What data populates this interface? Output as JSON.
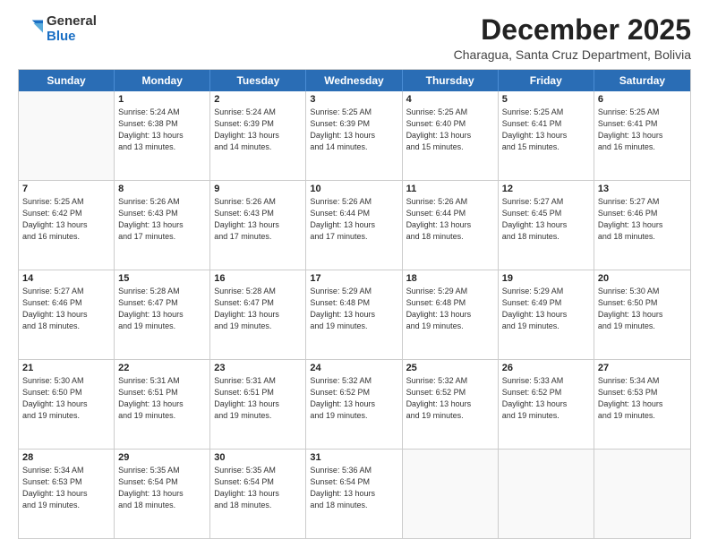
{
  "logo": {
    "general": "General",
    "blue": "Blue"
  },
  "header": {
    "month": "December 2025",
    "subtitle": "Charagua, Santa Cruz Department, Bolivia"
  },
  "days": [
    "Sunday",
    "Monday",
    "Tuesday",
    "Wednesday",
    "Thursday",
    "Friday",
    "Saturday"
  ],
  "weeks": [
    [
      {
        "day": "",
        "empty": true
      },
      {
        "day": "1",
        "sunrise": "Sunrise: 5:24 AM",
        "sunset": "Sunset: 6:38 PM",
        "daylight": "Daylight: 13 hours and 13 minutes."
      },
      {
        "day": "2",
        "sunrise": "Sunrise: 5:24 AM",
        "sunset": "Sunset: 6:39 PM",
        "daylight": "Daylight: 13 hours and 14 minutes."
      },
      {
        "day": "3",
        "sunrise": "Sunrise: 5:25 AM",
        "sunset": "Sunset: 6:39 PM",
        "daylight": "Daylight: 13 hours and 14 minutes."
      },
      {
        "day": "4",
        "sunrise": "Sunrise: 5:25 AM",
        "sunset": "Sunset: 6:40 PM",
        "daylight": "Daylight: 13 hours and 15 minutes."
      },
      {
        "day": "5",
        "sunrise": "Sunrise: 5:25 AM",
        "sunset": "Sunset: 6:41 PM",
        "daylight": "Daylight: 13 hours and 15 minutes."
      },
      {
        "day": "6",
        "sunrise": "Sunrise: 5:25 AM",
        "sunset": "Sunset: 6:41 PM",
        "daylight": "Daylight: 13 hours and 16 minutes."
      }
    ],
    [
      {
        "day": "7",
        "sunrise": "Sunrise: 5:25 AM",
        "sunset": "Sunset: 6:42 PM",
        "daylight": "Daylight: 13 hours and 16 minutes."
      },
      {
        "day": "8",
        "sunrise": "Sunrise: 5:26 AM",
        "sunset": "Sunset: 6:43 PM",
        "daylight": "Daylight: 13 hours and 17 minutes."
      },
      {
        "day": "9",
        "sunrise": "Sunrise: 5:26 AM",
        "sunset": "Sunset: 6:43 PM",
        "daylight": "Daylight: 13 hours and 17 minutes."
      },
      {
        "day": "10",
        "sunrise": "Sunrise: 5:26 AM",
        "sunset": "Sunset: 6:44 PM",
        "daylight": "Daylight: 13 hours and 17 minutes."
      },
      {
        "day": "11",
        "sunrise": "Sunrise: 5:26 AM",
        "sunset": "Sunset: 6:44 PM",
        "daylight": "Daylight: 13 hours and 18 minutes."
      },
      {
        "day": "12",
        "sunrise": "Sunrise: 5:27 AM",
        "sunset": "Sunset: 6:45 PM",
        "daylight": "Daylight: 13 hours and 18 minutes."
      },
      {
        "day": "13",
        "sunrise": "Sunrise: 5:27 AM",
        "sunset": "Sunset: 6:46 PM",
        "daylight": "Daylight: 13 hours and 18 minutes."
      }
    ],
    [
      {
        "day": "14",
        "sunrise": "Sunrise: 5:27 AM",
        "sunset": "Sunset: 6:46 PM",
        "daylight": "Daylight: 13 hours and 18 minutes."
      },
      {
        "day": "15",
        "sunrise": "Sunrise: 5:28 AM",
        "sunset": "Sunset: 6:47 PM",
        "daylight": "Daylight: 13 hours and 19 minutes."
      },
      {
        "day": "16",
        "sunrise": "Sunrise: 5:28 AM",
        "sunset": "Sunset: 6:47 PM",
        "daylight": "Daylight: 13 hours and 19 minutes."
      },
      {
        "day": "17",
        "sunrise": "Sunrise: 5:29 AM",
        "sunset": "Sunset: 6:48 PM",
        "daylight": "Daylight: 13 hours and 19 minutes."
      },
      {
        "day": "18",
        "sunrise": "Sunrise: 5:29 AM",
        "sunset": "Sunset: 6:48 PM",
        "daylight": "Daylight: 13 hours and 19 minutes."
      },
      {
        "day": "19",
        "sunrise": "Sunrise: 5:29 AM",
        "sunset": "Sunset: 6:49 PM",
        "daylight": "Daylight: 13 hours and 19 minutes."
      },
      {
        "day": "20",
        "sunrise": "Sunrise: 5:30 AM",
        "sunset": "Sunset: 6:50 PM",
        "daylight": "Daylight: 13 hours and 19 minutes."
      }
    ],
    [
      {
        "day": "21",
        "sunrise": "Sunrise: 5:30 AM",
        "sunset": "Sunset: 6:50 PM",
        "daylight": "Daylight: 13 hours and 19 minutes."
      },
      {
        "day": "22",
        "sunrise": "Sunrise: 5:31 AM",
        "sunset": "Sunset: 6:51 PM",
        "daylight": "Daylight: 13 hours and 19 minutes."
      },
      {
        "day": "23",
        "sunrise": "Sunrise: 5:31 AM",
        "sunset": "Sunset: 6:51 PM",
        "daylight": "Daylight: 13 hours and 19 minutes."
      },
      {
        "day": "24",
        "sunrise": "Sunrise: 5:32 AM",
        "sunset": "Sunset: 6:52 PM",
        "daylight": "Daylight: 13 hours and 19 minutes."
      },
      {
        "day": "25",
        "sunrise": "Sunrise: 5:32 AM",
        "sunset": "Sunset: 6:52 PM",
        "daylight": "Daylight: 13 hours and 19 minutes."
      },
      {
        "day": "26",
        "sunrise": "Sunrise: 5:33 AM",
        "sunset": "Sunset: 6:52 PM",
        "daylight": "Daylight: 13 hours and 19 minutes."
      },
      {
        "day": "27",
        "sunrise": "Sunrise: 5:34 AM",
        "sunset": "Sunset: 6:53 PM",
        "daylight": "Daylight: 13 hours and 19 minutes."
      }
    ],
    [
      {
        "day": "28",
        "sunrise": "Sunrise: 5:34 AM",
        "sunset": "Sunset: 6:53 PM",
        "daylight": "Daylight: 13 hours and 19 minutes."
      },
      {
        "day": "29",
        "sunrise": "Sunrise: 5:35 AM",
        "sunset": "Sunset: 6:54 PM",
        "daylight": "Daylight: 13 hours and 18 minutes."
      },
      {
        "day": "30",
        "sunrise": "Sunrise: 5:35 AM",
        "sunset": "Sunset: 6:54 PM",
        "daylight": "Daylight: 13 hours and 18 minutes."
      },
      {
        "day": "31",
        "sunrise": "Sunrise: 5:36 AM",
        "sunset": "Sunset: 6:54 PM",
        "daylight": "Daylight: 13 hours and 18 minutes."
      },
      {
        "day": "",
        "empty": true
      },
      {
        "day": "",
        "empty": true
      },
      {
        "day": "",
        "empty": true
      }
    ]
  ]
}
